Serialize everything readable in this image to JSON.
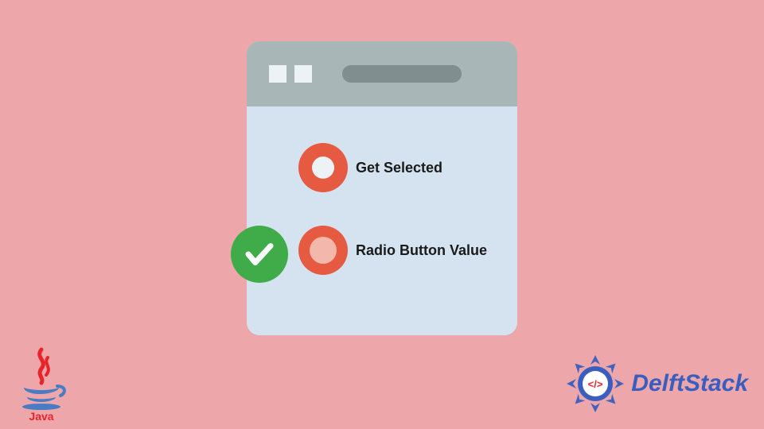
{
  "radios": {
    "option1": {
      "label": "Get Selected"
    },
    "option2": {
      "label": "Radio Button Value"
    }
  },
  "branding": {
    "java_label": "Java",
    "delftstack_label": "DelftStack"
  },
  "colors": {
    "background": "#eda6a9",
    "window_body": "#d5e2ef",
    "titlebar": "#a9b6b8",
    "radio_ring": "#e65a42",
    "check_bg": "#3fac49",
    "brand_text": "#3a5ec0"
  }
}
